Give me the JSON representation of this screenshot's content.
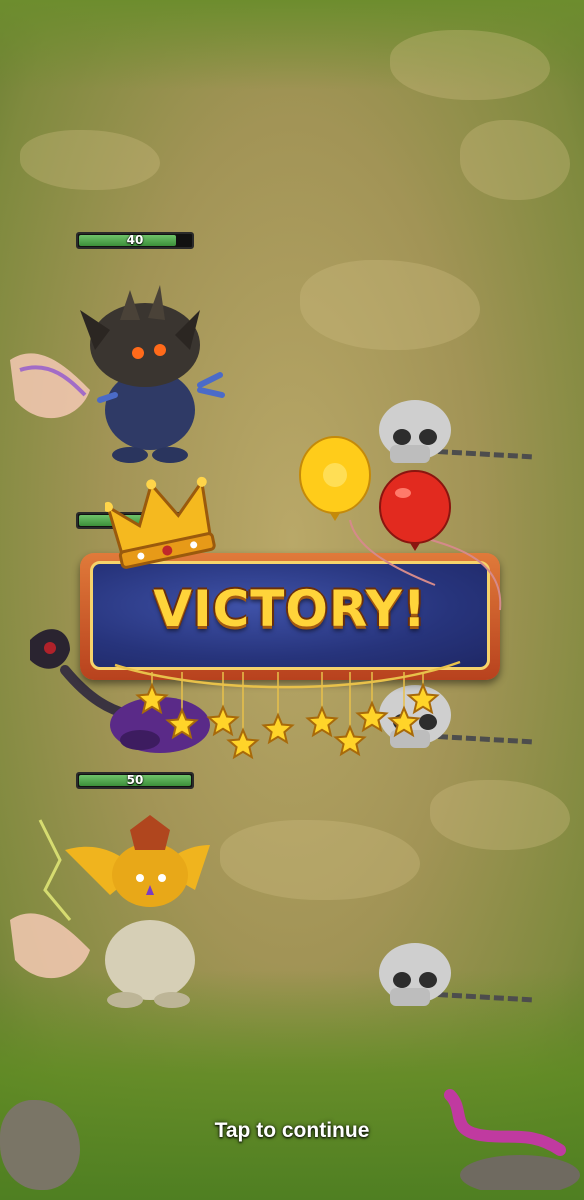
{
  "result": {
    "title": "VICTORY!",
    "prompt": "Tap to continue",
    "stars_count": 10,
    "stars_earned": 10
  },
  "allies": [
    {
      "name": "dark-horned-beast",
      "hp": "40",
      "hp_fraction": 0.87
    },
    {
      "name": "purple-shadow-beast",
      "hp": "",
      "hp_fraction": 0.75
    },
    {
      "name": "golden-lightning-beast",
      "hp": "50",
      "hp_fraction": 1.0
    }
  ],
  "enemies": [
    {
      "name": "defeated-skull",
      "state": "defeated"
    },
    {
      "name": "defeated-skull",
      "state": "defeated"
    },
    {
      "name": "defeated-skull",
      "state": "defeated"
    }
  ],
  "colors": {
    "banner_blue": "#27347c",
    "banner_border": "#f6d36b",
    "victory_text": "#ffd43a",
    "hp_green": "#3c8f3a",
    "balloon_yellow": "#ffcc1a",
    "balloon_red": "#e22a1f"
  },
  "icons": [
    "crown-icon",
    "yellow-balloon-icon",
    "red-balloon-icon",
    "star-icon",
    "skull-icon"
  ]
}
